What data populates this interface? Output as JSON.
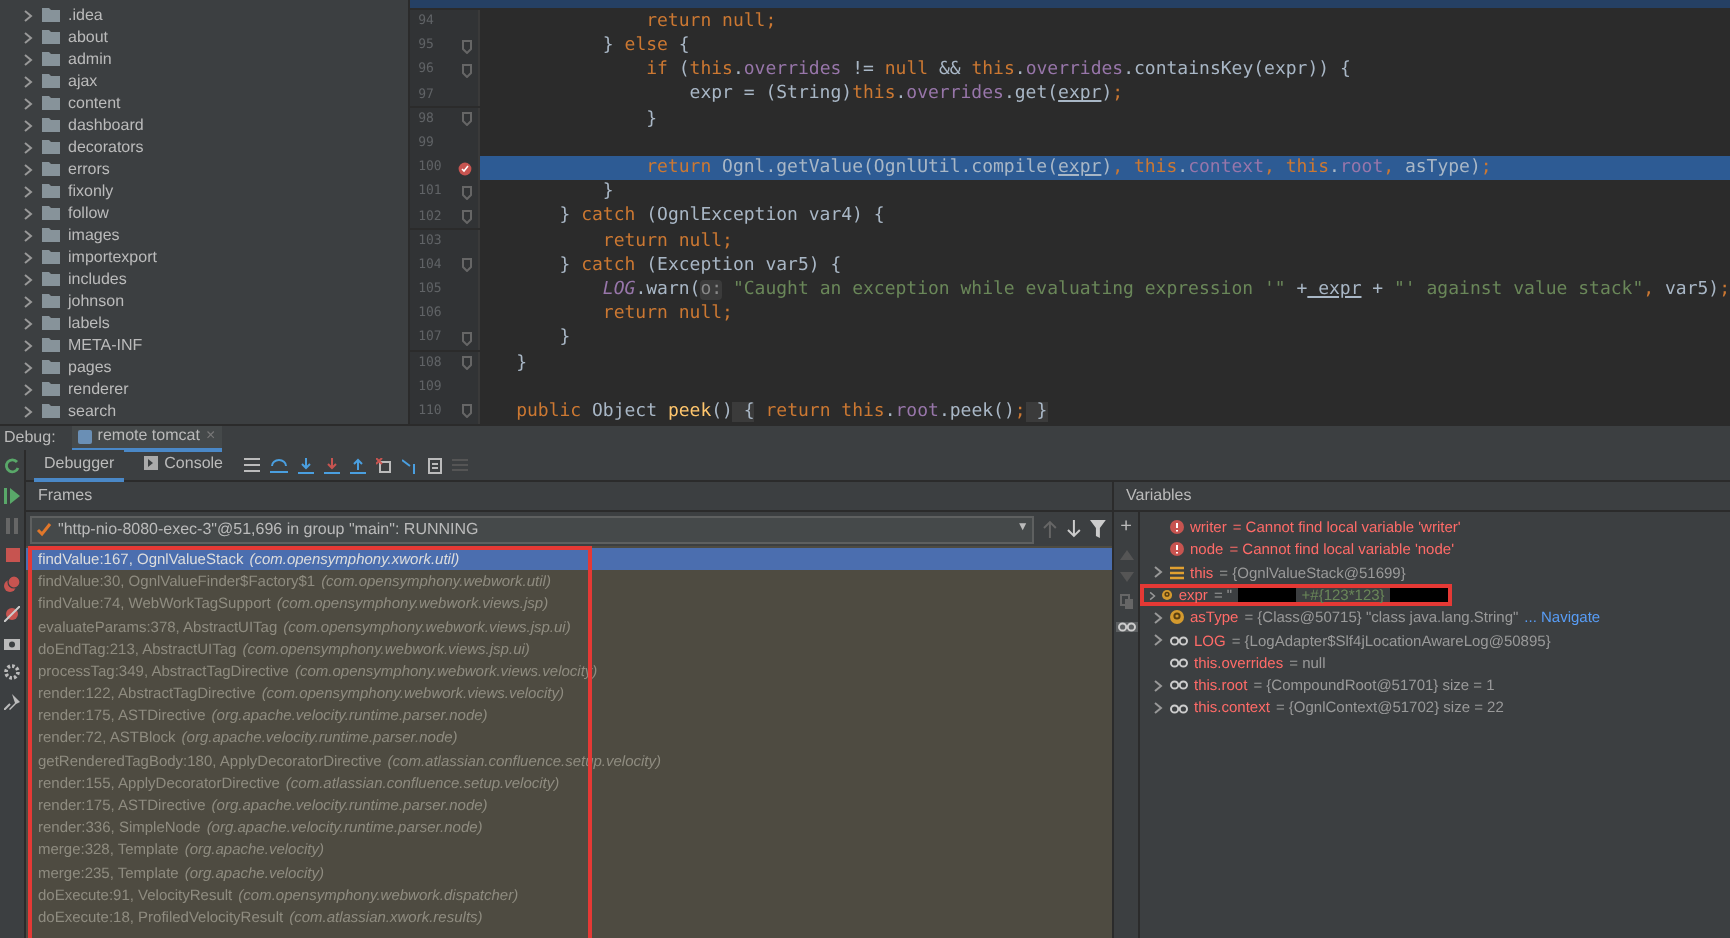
{
  "project_tree": [
    {
      "label": ".idea",
      "expanded": false
    },
    {
      "label": "about",
      "expanded": false
    },
    {
      "label": "admin",
      "expanded": false
    },
    {
      "label": "ajax",
      "expanded": false
    },
    {
      "label": "content",
      "expanded": false
    },
    {
      "label": "dashboard",
      "expanded": false
    },
    {
      "label": "decorators",
      "expanded": false
    },
    {
      "label": "errors",
      "expanded": false
    },
    {
      "label": "fixonly",
      "expanded": false
    },
    {
      "label": "follow",
      "expanded": false
    },
    {
      "label": "images",
      "expanded": false
    },
    {
      "label": "importexport",
      "expanded": false
    },
    {
      "label": "includes",
      "expanded": false
    },
    {
      "label": "johnson",
      "expanded": false
    },
    {
      "label": "labels",
      "expanded": false
    },
    {
      "label": "META-INF",
      "expanded": false
    },
    {
      "label": "pages",
      "expanded": false
    },
    {
      "label": "renderer",
      "expanded": false
    },
    {
      "label": "search",
      "expanded": false
    }
  ],
  "editor": {
    "lines": [
      {
        "number": "94",
        "fold": false,
        "breakpoint": false,
        "selected": false,
        "code": [
          {
            "kind": "kw",
            "t": "            return null;"
          }
        ]
      },
      {
        "number": "95",
        "fold": true,
        "breakpoint": false,
        "selected": false,
        "code": [
          {
            "kind": "plain",
            "t": "        }"
          },
          {
            "kind": "kw",
            "t": " else"
          },
          {
            "kind": "plain",
            "t": " {"
          }
        ]
      },
      {
        "number": "96",
        "fold": true,
        "breakpoint": false,
        "selected": false,
        "code": [
          {
            "kind": "kw",
            "t": "            if"
          },
          {
            "kind": "plain",
            "t": " ("
          },
          {
            "kind": "kw",
            "t": "this"
          },
          {
            "kind": "plain",
            "t": "."
          },
          {
            "kind": "field",
            "t": "overrides"
          },
          {
            "kind": "plain",
            "t": " !="
          },
          {
            "kind": "kw",
            "t": " null"
          },
          {
            "kind": "plain",
            "t": " &&"
          },
          {
            "kind": "kw",
            "t": " this"
          },
          {
            "kind": "plain",
            "t": "."
          },
          {
            "kind": "field",
            "t": "overrides"
          },
          {
            "kind": "plain",
            "t": ".containsKey(expr)) {"
          }
        ]
      },
      {
        "number": "97",
        "fold": false,
        "breakpoint": false,
        "selected": false,
        "code": [
          {
            "kind": "plain",
            "t": "                expr"
          },
          {
            "kind": "plain",
            "t": " = (String)"
          },
          {
            "kind": "kw",
            "t": "this"
          },
          {
            "kind": "plain",
            "t": "."
          },
          {
            "kind": "field",
            "t": "overrides"
          },
          {
            "kind": "plain",
            "t": ".get("
          },
          {
            "kind": "var",
            "t": "expr"
          },
          {
            "kind": "plain",
            "t": ")"
          },
          {
            "kind": "kw",
            "t": ";"
          }
        ]
      },
      {
        "number": "98",
        "fold": true,
        "breakpoint": false,
        "selected": false,
        "code": [
          {
            "kind": "plain",
            "t": "            }"
          }
        ]
      },
      {
        "number": "99",
        "fold": false,
        "breakpoint": false,
        "selected": false
      },
      {
        "number": "100",
        "fold": false,
        "breakpoint": true,
        "selected": true,
        "code": [
          {
            "kind": "kw",
            "t": "            return"
          },
          {
            "kind": "plain",
            "t": " Ognl.getValue(OgnlUtil.compile("
          },
          {
            "kind": "var",
            "t": "expr"
          },
          {
            "kind": "plain",
            "t": ")"
          },
          {
            "kind": "kw",
            "t": ", this"
          },
          {
            "kind": "plain",
            "t": "."
          },
          {
            "kind": "field",
            "t": "context"
          },
          {
            "kind": "kw",
            "t": ", this"
          },
          {
            "kind": "plain",
            "t": "."
          },
          {
            "kind": "field",
            "t": "root"
          },
          {
            "kind": "kw",
            "t": ","
          },
          {
            "kind": "plain",
            "t": " asType)"
          },
          {
            "kind": "kw",
            "t": ";"
          }
        ]
      },
      {
        "number": "101",
        "fold": true,
        "breakpoint": false,
        "selected": false,
        "code": [
          {
            "kind": "plain",
            "t": "        }"
          }
        ]
      },
      {
        "number": "102",
        "fold": true,
        "breakpoint": false,
        "selected": false,
        "code": [
          {
            "kind": "plain",
            "t": "    }"
          },
          {
            "kind": "kw",
            "t": " catch"
          },
          {
            "kind": "plain",
            "t": " (OgnlException var4) {"
          }
        ]
      },
      {
        "number": "103",
        "fold": false,
        "breakpoint": false,
        "selected": false,
        "code": [
          {
            "kind": "kw",
            "t": "        return null;"
          }
        ]
      },
      {
        "number": "104",
        "fold": true,
        "breakpoint": false,
        "selected": false,
        "code": [
          {
            "kind": "plain",
            "t": "    }"
          },
          {
            "kind": "kw",
            "t": " catch"
          },
          {
            "kind": "plain",
            "t": " (Exception var5) {"
          }
        ]
      },
      {
        "number": "105",
        "fold": false,
        "breakpoint": false,
        "selected": false,
        "code": [
          {
            "kind": "static",
            "t": "        LOG"
          },
          {
            "kind": "plain",
            "t": ".warn("
          },
          {
            "kind": "hint",
            "t": "o:"
          },
          {
            "kind": "str",
            "t": " \"Caught an exception while evaluating expression '\""
          },
          {
            "kind": "plain",
            "t": " +"
          },
          {
            "kind": "var",
            "t": " expr"
          },
          {
            "kind": "plain",
            "t": " +"
          },
          {
            "kind": "str",
            "t": " \"' against value stack\""
          },
          {
            "kind": "kw",
            "t": ","
          },
          {
            "kind": "plain",
            "t": " var5)"
          },
          {
            "kind": "kw",
            "t": ";"
          }
        ]
      },
      {
        "number": "106",
        "fold": false,
        "breakpoint": false,
        "selected": false,
        "code": [
          {
            "kind": "kw",
            "t": "        return null;"
          }
        ]
      },
      {
        "number": "107",
        "fold": true,
        "breakpoint": false,
        "selected": false,
        "code": [
          {
            "kind": "plain",
            "t": "    }"
          }
        ]
      },
      {
        "number": "108",
        "fold": true,
        "breakpoint": false,
        "selected": false,
        "code": [
          {
            "kind": "plain",
            "t": "}"
          }
        ]
      },
      {
        "number": "109",
        "fold": false,
        "breakpoint": false,
        "selected": false
      },
      {
        "number": "110",
        "fold": true,
        "breakpoint": false,
        "selected": false,
        "code": [
          {
            "kind": "kw",
            "t": "public"
          },
          {
            "kind": "plain",
            "t": " Object"
          },
          {
            "kind": "method",
            "t": " peek"
          },
          {
            "kind": "plain",
            "t": "()"
          },
          {
            "kind": "brace",
            "t": " {"
          },
          {
            "kind": "kw",
            "t": " return this"
          },
          {
            "kind": "plain",
            "t": "."
          },
          {
            "kind": "field",
            "t": "root"
          },
          {
            "kind": "plain",
            "t": ".peek()"
          },
          {
            "kind": "kw",
            "t": ";"
          },
          {
            "kind": "brace",
            "t": " }"
          }
        ]
      }
    ]
  },
  "debug": {
    "label": "Debug:",
    "session_tab": "remote tomcat",
    "session_close": "×",
    "dropdown_arrow": "▼",
    "add_watch": "+",
    "watches_shown": true,
    "tabs": [
      {
        "label": "Debugger",
        "selected": true
      },
      {
        "label": "Console",
        "selected": false
      }
    ],
    "frames_title": "Frames",
    "thread": "\"http-nio-8080-exec-3\"@51,696 in group \"main\": RUNNING",
    "frames_outlined": true,
    "frames": [
      {
        "method": "findValue:167, OgnlValueStack",
        "package": "(com.opensymphony.xwork.util)",
        "selected": true
      },
      {
        "method": "findValue:30, OgnlValueFinder$Factory$1",
        "package": "(com.opensymphony.webwork.util)",
        "selected": false
      },
      {
        "method": "findValue:74, WebWorkTagSupport",
        "package": "(com.opensymphony.webwork.views.jsp)",
        "selected": false
      },
      {
        "method": "evaluateParams:378, AbstractUITag",
        "package": "(com.opensymphony.webwork.views.jsp.ui)",
        "selected": false
      },
      {
        "method": "doEndTag:213, AbstractUITag",
        "package": "(com.opensymphony.webwork.views.jsp.ui)",
        "selected": false
      },
      {
        "method": "processTag:349, AbstractTagDirective",
        "package": "(com.opensymphony.webwork.views.velocity)",
        "selected": false
      },
      {
        "method": "render:122, AbstractTagDirective",
        "package": "(com.opensymphony.webwork.views.velocity)",
        "selected": false
      },
      {
        "method": "render:175, ASTDirective",
        "package": "(org.apache.velocity.runtime.parser.node)",
        "selected": false
      },
      {
        "method": "render:72, ASTBlock",
        "package": "(org.apache.velocity.runtime.parser.node)",
        "selected": false
      },
      {
        "method": "getRenderedTagBody:180, ApplyDecoratorDirective",
        "package": "(com.atlassian.confluence.setup.velocity)",
        "selected": false
      },
      {
        "method": "render:155, ApplyDecoratorDirective",
        "package": "(com.atlassian.confluence.setup.velocity)",
        "selected": false
      },
      {
        "method": "render:175, ASTDirective",
        "package": "(org.apache.velocity.runtime.parser.node)",
        "selected": false
      },
      {
        "method": "render:336, SimpleNode",
        "package": "(org.apache.velocity.runtime.parser.node)",
        "selected": false
      },
      {
        "method": "merge:328, Template",
        "package": "(org.apache.velocity)",
        "selected": false
      },
      {
        "method": "merge:235, Template",
        "package": "(org.apache.velocity)",
        "selected": false
      },
      {
        "method": "doExecute:91, VelocityResult",
        "package": "(com.opensymphony.webwork.dispatcher)",
        "selected": false
      },
      {
        "method": "doExecute:18, ProfiledVelocityResult",
        "package": "(com.atlassian.xwork.results)",
        "selected": false
      }
    ],
    "variables_title": "Variables",
    "variables": [
      {
        "kind": "error",
        "expandable": false,
        "outlined": false,
        "name": "writer",
        "value": "= Cannot find local variable 'writer'"
      },
      {
        "kind": "error",
        "expandable": false,
        "outlined": false,
        "name": "node",
        "value": "= Cannot find local variable 'node'"
      },
      {
        "kind": "object",
        "expandable": true,
        "outlined": false,
        "name": "this",
        "value": "= {OgnlValueStack@51699}"
      },
      {
        "kind": "param",
        "expandable": true,
        "outlined": true,
        "name": "expr",
        "value": "= \"",
        "redacted_tail": "+#{123*123}"
      },
      {
        "kind": "param",
        "expandable": true,
        "outlined": false,
        "name": "asType",
        "value": "= {Class@50715} \"class java.lang.String\"",
        "link": "... Navigate"
      },
      {
        "kind": "watch",
        "expandable": true,
        "outlined": false,
        "name": "LOG",
        "value": "= {LogAdapter$Slf4jLocationAwareLog@50895}"
      },
      {
        "kind": "watch",
        "expandable": false,
        "outlined": false,
        "name": "this.overrides",
        "value": "= null"
      },
      {
        "kind": "watch",
        "expandable": true,
        "outlined": false,
        "name": "this.root",
        "value": "= {CompoundRoot@51701}  size = 1"
      },
      {
        "kind": "watch",
        "expandable": true,
        "outlined": false,
        "name": "this.context",
        "value": "= {OgnlContext@51702}  size = 22"
      }
    ]
  }
}
